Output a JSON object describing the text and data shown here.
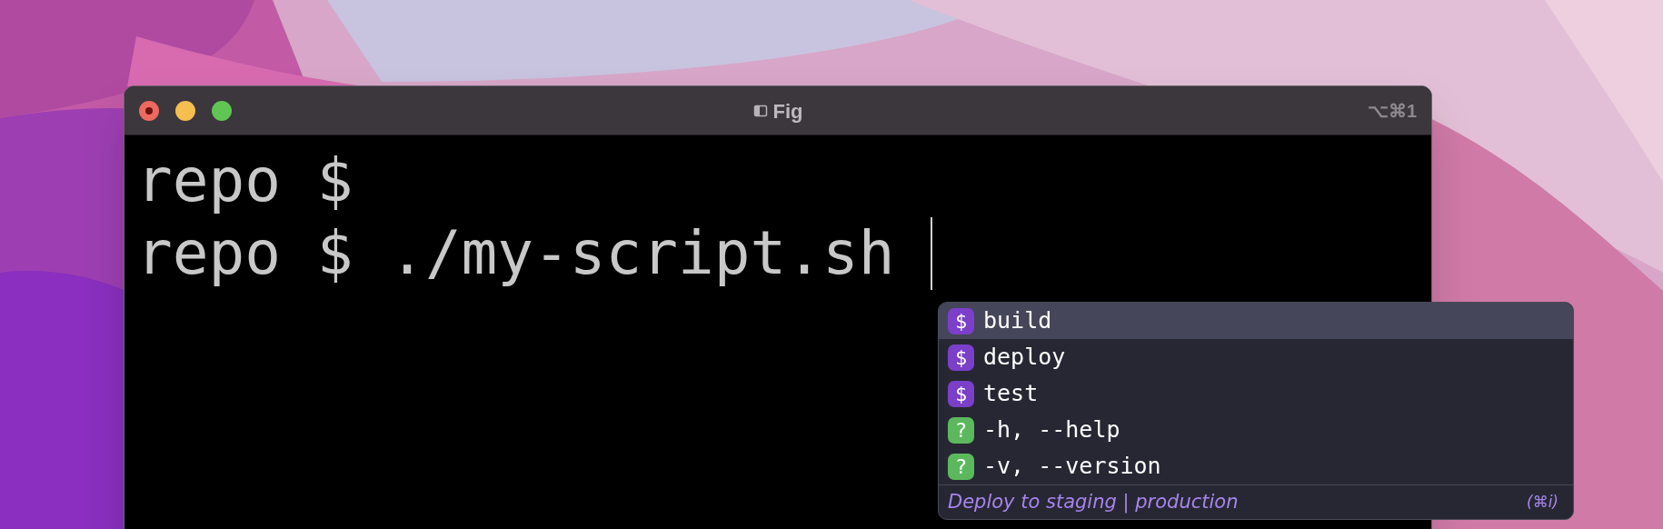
{
  "window": {
    "title": "Fig",
    "shortcut": "⌥⌘1"
  },
  "terminal": {
    "lines": [
      "repo $",
      "repo $ ./my-script.sh"
    ]
  },
  "autocomplete": {
    "items": [
      {
        "kind": "subcommand",
        "icon": "$",
        "label": "build",
        "selected": true
      },
      {
        "kind": "subcommand",
        "icon": "$",
        "label": "deploy",
        "selected": false
      },
      {
        "kind": "subcommand",
        "icon": "$",
        "label": "test",
        "selected": false
      },
      {
        "kind": "option",
        "icon": "?",
        "label": "-h, --help",
        "selected": false
      },
      {
        "kind": "option",
        "icon": "?",
        "label": "-v, --version",
        "selected": false
      }
    ],
    "description": "Deploy to staging | production",
    "shortcut": "(⌘i)"
  }
}
